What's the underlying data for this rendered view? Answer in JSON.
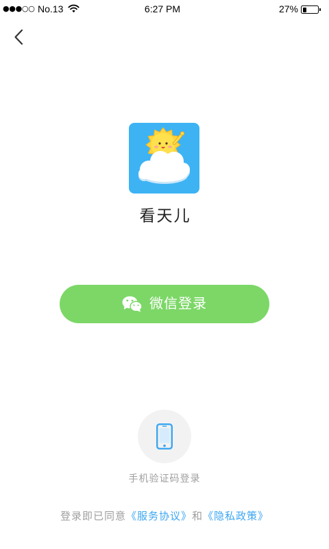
{
  "status_bar": {
    "signal": "●●●○○",
    "carrier": "No.13",
    "time": "6:27 PM",
    "battery_percent": "27%",
    "battery_level": 0.27,
    "wifi_icon": "wifi-icon",
    "battery_icon": "battery-icon"
  },
  "nav": {
    "back_icon": "chevron-left-icon"
  },
  "app": {
    "name": "看天儿",
    "icon": "sun-cloud-app-icon"
  },
  "wechat_login": {
    "label": "微信登录",
    "icon": "wechat-icon"
  },
  "phone_login": {
    "label": "手机验证码登录",
    "icon": "mobile-phone-icon"
  },
  "agreement": {
    "prefix": "登录即已同意",
    "terms_link": "《服务协议》",
    "conjunction": "和",
    "privacy_link": "《隐私政策》"
  },
  "colors": {
    "wechat_green": "#7CD767",
    "link_blue": "#3BA6F2",
    "app_icon_blue": "#3DB3F4",
    "sun_yellow": "#FFD43B",
    "muted_gray": "#9E9E9E",
    "circle_bg": "#F2F2F2"
  }
}
